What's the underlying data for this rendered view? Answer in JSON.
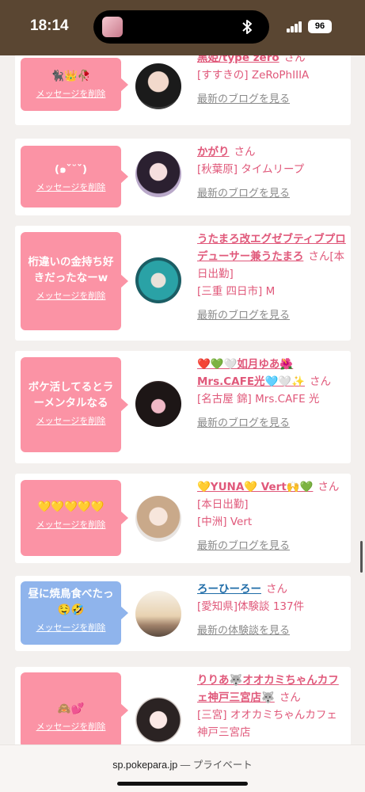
{
  "status_bar": {
    "time": "18:14",
    "battery": "96"
  },
  "delete_label": "メッセージを削除",
  "san_label": "さん",
  "cards": [
    {
      "message": "🐈‍⬛👑🥀",
      "name": "黒姫/type zero",
      "extra": "",
      "shop": "[すすきの] ZeRoPhIIIA",
      "link": "最新のブログを見る"
    },
    {
      "message": "(๑ˇ˘ˇ)",
      "name": "かがり",
      "extra": "",
      "shop": "[秋葉原] タイムリープ",
      "link": "最新のブログを見る"
    },
    {
      "message": "桁違いの金持ち好きだったなーw",
      "name": "うたまろ改エグゼブティブプロデューサー兼うたまろ",
      "extra": "[本日出勤]",
      "shop": "[三重 四日市] M",
      "link": "最新のブログを見る"
    },
    {
      "message": "ボケ活してるとラーメンタルなる",
      "name": "❤️💚🤍如月ゆあ🌺Mrs.CAFE光🩵🤍✨",
      "extra": "",
      "shop": "[名古屋 錦] Mrs.CAFE 光",
      "link": "最新のブログを見る"
    },
    {
      "message": "💛💛💛💛💛",
      "name": "💛YUNA💛 Vert🙌💚",
      "extra": "[本日出勤]",
      "shop": "[中洲] Vert",
      "link": "最新のブログを見る"
    },
    {
      "message": "昼に焼鳥食べたっ🤤🤣",
      "name": "ろーひーろー",
      "extra": "",
      "shop": "[愛知県]体験談 137件",
      "link": "最新の体験談を見る"
    },
    {
      "message": "🙈💕",
      "name": "りりあ🐺オオカミちゃんカフェ神戸三宮店🐺",
      "extra": "",
      "shop": "[三宮] オオカミちゃんカフェ神戸三宮店",
      "link": ""
    }
  ],
  "browser": {
    "domain": "sp.pokepara.jp",
    "separator": "—",
    "mode": "プライベート"
  },
  "colors": {
    "pink": "#fb93a5",
    "blue": "#8fb4ec",
    "name_pink": "#e0587a",
    "name_blue": "#1f6ca8"
  }
}
